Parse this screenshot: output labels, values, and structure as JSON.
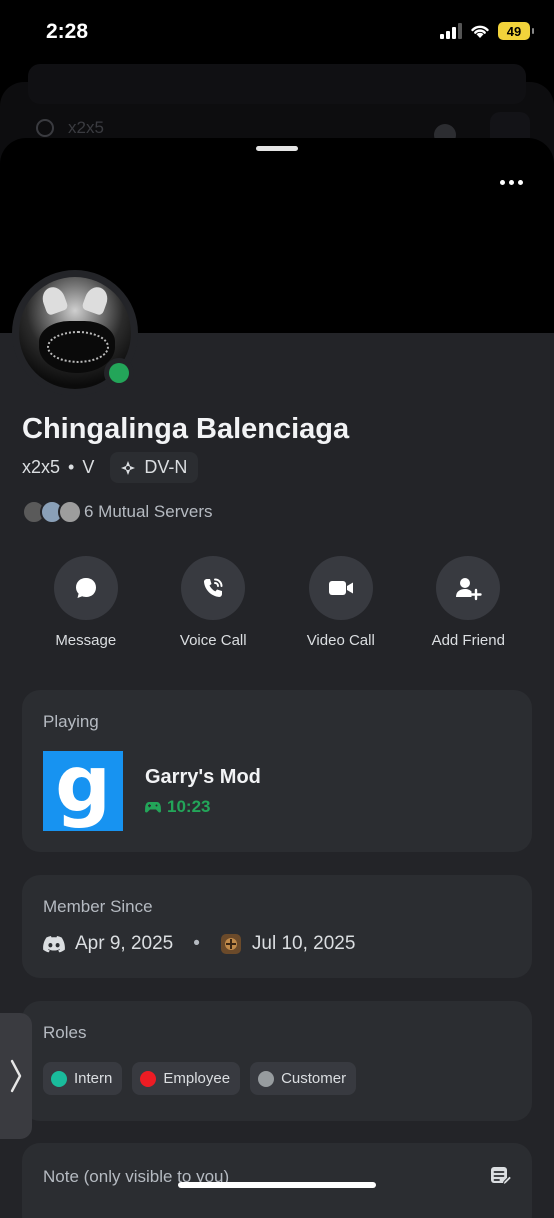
{
  "status_bar": {
    "time": "2:28",
    "battery": "49"
  },
  "background": {
    "search_text": "x2x5"
  },
  "profile": {
    "display_name": "Chingalinga Balenciaga",
    "username": "x2x5",
    "separator": "•",
    "pronoun_tag": "V",
    "clan_tag": "DV-N",
    "mutual_servers": "6 Mutual Servers",
    "online_status_color": "#23a559"
  },
  "actions": [
    {
      "label": "Message",
      "icon": "chat-bubble-icon"
    },
    {
      "label": "Voice Call",
      "icon": "phone-icon"
    },
    {
      "label": "Video Call",
      "icon": "video-camera-icon"
    },
    {
      "label": "Add Friend",
      "icon": "add-person-icon"
    }
  ],
  "activity": {
    "title": "Playing",
    "game_name": "Garry's Mod",
    "game_icon_letter": "g",
    "elapsed": "10:23"
  },
  "member_since": {
    "title": "Member Since",
    "discord_date": "Apr 9, 2025",
    "separator": "•",
    "server_date": "Jul 10, 2025"
  },
  "roles": {
    "title": "Roles",
    "items": [
      {
        "name": "Intern",
        "color": "#1abc9c"
      },
      {
        "name": "Employee",
        "color": "#ed1c24"
      },
      {
        "name": "Customer",
        "color": "#979c9f"
      }
    ]
  },
  "note": {
    "label": "Note (only visible to you)"
  }
}
